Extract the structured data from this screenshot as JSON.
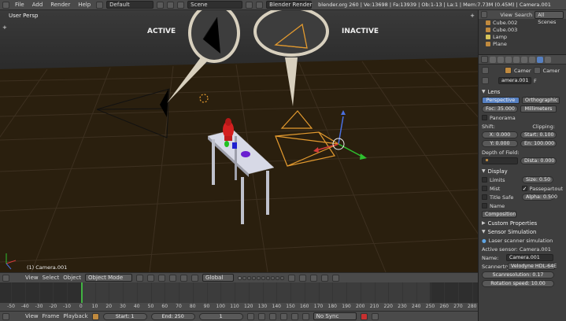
{
  "topbar": {
    "menus": [
      "File",
      "Add",
      "Render",
      "Help"
    ],
    "layout": "Default",
    "scene": "Scene",
    "engine": "Blender Render",
    "stats": "blender.org 260 | Ve:13698 | Fa:13939 | Ob:1-13 | La:1 | Mem:7.73M (0.45M) | Camera.001"
  },
  "viewport": {
    "view_name": "User Persp",
    "active_label": "ACTIVE",
    "inactive_label": "INACTIVE",
    "selected_object": "(1) Camera.001"
  },
  "view_header": {
    "menus": [
      "View",
      "Select",
      "Object"
    ],
    "mode": "Object Mode",
    "orientation": "Global"
  },
  "timeline": {
    "ticks": [
      "-50",
      "-40",
      "-30",
      "-20",
      "-10",
      "0",
      "10",
      "20",
      "30",
      "40",
      "50",
      "60",
      "70",
      "80",
      "90",
      "100",
      "110",
      "120",
      "130",
      "140",
      "150",
      "160",
      "170",
      "180",
      "190",
      "200",
      "210",
      "220",
      "230",
      "240",
      "250",
      "260",
      "270",
      "280"
    ],
    "current_frame": 1
  },
  "playback": {
    "menus": [
      "View",
      "Frame",
      "Playback"
    ],
    "start": "Start: 1",
    "end": "End: 250",
    "current": "1",
    "sync": "No Sync"
  },
  "outliner": {
    "view_label": "View",
    "search_label": "Search",
    "filter": "All Scenes",
    "items": [
      "Cube.002",
      "Cube.003",
      "Lamp",
      "Plane"
    ]
  },
  "properties": {
    "breadcrumb_camera": "Camer",
    "breadcrumb_data": "Camer",
    "data_name": "amera.001",
    "fake_user": "F",
    "lens_section": "Lens",
    "perspective_btn": "Perspective",
    "orthographic_btn": "Orthographic",
    "focal": "Foc: 35.000",
    "units": "Millimeters",
    "panorama": "Panorama",
    "shift_label": "Shift:",
    "clipping_label": "Clipping:",
    "shift_x": "X: 0.000",
    "shift_y": "Y: 0.000",
    "clip_start": "Start: 0.100",
    "clip_end": "En: 100.000",
    "dof_label": "Depth of Field:",
    "dof_distance": "Dista: 0.000",
    "display_section": "Display",
    "limits": "Limits",
    "size": "Size: 0.50",
    "mist": "Mist",
    "passepartout": "Passepartout",
    "title_safe": "Title Safe",
    "alpha": "Alpha: 0.500",
    "name": "Name",
    "composition": "Composition",
    "custom_props": "Custom Properties",
    "sensor_section": "Sensor Simulation",
    "laser_sim": "Laser scanner simulation",
    "active_sensor": "Active sensor: Camera.001",
    "name_label": "Name:",
    "name_value": "Camera.001",
    "scanner_label": "Scannertry:",
    "scanner_value": "Velodyne HDL-64E",
    "scan_res": "Scanresolution: 0.17",
    "rot_speed": "Rotation speed: 10.00"
  }
}
